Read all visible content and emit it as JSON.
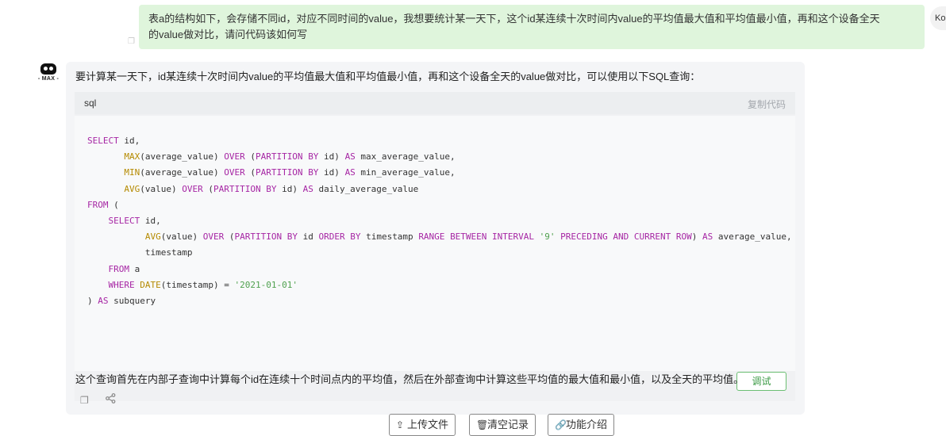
{
  "user_message": {
    "line1": "表a的结构如下，会存储不同id，对应不同时间的value，我想要统计某一天下，这个id某连续十次时间内value的平均值最大值和平均值最小值，再和这个设备全天",
    "line2": "的value做对比，请问代码该如何写",
    "avatar_text": "Ko"
  },
  "bot": {
    "avatar_label": "- MAX -",
    "intro": "要计算某一天下，id某连续十次时间内value的平均值最大值和平均值最小值，再和这个设备全天的value做对比，可以使用以下SQL查询：",
    "code_lang": "sql",
    "copy_code": "复制代码",
    "debug_button": "调试",
    "summary": "这个查询首先在内部子查询中计算每个id在连续十个时间点内的平均值，然后在外部查询中计算这些平均值的最大值和最小值，以及全天的平均值。",
    "code_lines": [
      "SELECT id,",
      "       MAX(average_value) OVER (PARTITION BY id) AS max_average_value,",
      "       MIN(average_value) OVER (PARTITION BY id) AS min_average_value,",
      "       AVG(value) OVER (PARTITION BY id) AS daily_average_value",
      "FROM (",
      "    SELECT id,",
      "           AVG(value) OVER (PARTITION BY id ORDER BY timestamp RANGE BETWEEN INTERVAL '9' PRECEDING AND CURRENT ROW) AS average_value,",
      "           timestamp",
      "    FROM a",
      "    WHERE DATE(timestamp) = '2021-01-01'",
      ") AS subquery"
    ]
  },
  "bottom_bar": {
    "upload": "上传文件",
    "clear": "清空记录",
    "features": "功能介绍"
  },
  "icons": {
    "copy": "copy-icon",
    "share": "share-icon",
    "upload": "upload-icon",
    "trash": "trash-icon",
    "link": "link-icon"
  },
  "colors": {
    "user_bubble": "#dff5dc",
    "bot_panel": "#f4f5f7",
    "keyword": "#a626a4",
    "function": "#b58a00",
    "string": "#50a14f",
    "debug_button": "#3a9a44"
  }
}
